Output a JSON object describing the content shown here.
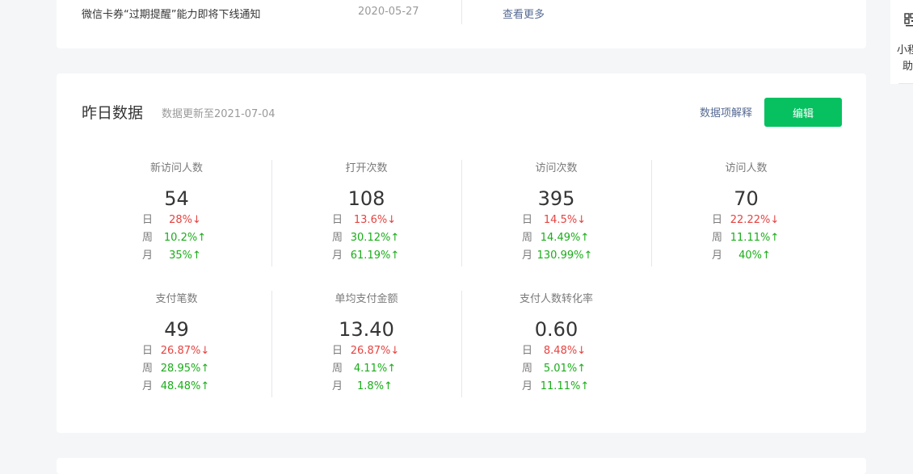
{
  "notice": {
    "title": "微信卡券“过期提醒”能力即将下线通知",
    "date": "2020-05-27",
    "more_label": "查看更多"
  },
  "helper": {
    "text_line1": "小程",
    "text_line2": "助"
  },
  "yesterday": {
    "title": "昨日数据",
    "subtitle": "数据更新至2021-07-04",
    "explain_label": "数据项解释",
    "edit_label": "编辑",
    "compare_keys": {
      "day": "日",
      "week": "周",
      "month": "月"
    },
    "metrics": [
      {
        "label": "新访问人数",
        "value": "54",
        "day": "28%↓",
        "week": "10.2%↑",
        "month": "35%↑"
      },
      {
        "label": "打开次数",
        "value": "108",
        "day": "13.6%↓",
        "week": "30.12%↑",
        "month": "61.19%↑"
      },
      {
        "label": "访问次数",
        "value": "395",
        "day": "14.5%↓",
        "week": "14.49%↑",
        "month": "130.99%↑"
      },
      {
        "label": "访问人数",
        "value": "70",
        "day": "22.22%↓",
        "week": "11.11%↑",
        "month": "40%↑"
      },
      {
        "label": "支付笔数",
        "value": "49",
        "day": "26.87%↓",
        "week": "28.95%↑",
        "month": "48.48%↑"
      },
      {
        "label": "单均支付金额",
        "value": "13.40",
        "day": "26.87%↓",
        "week": "4.11%↑",
        "month": "1.8%↑"
      },
      {
        "label": "支付人数转化率",
        "value": "0.60",
        "day": "8.48%↓",
        "week": "5.01%↑",
        "month": "11.11%↑"
      }
    ]
  },
  "colors": {
    "up": "#1aad19",
    "down": "#e64340",
    "primary_button": "#07c160",
    "link": "#576b95"
  }
}
